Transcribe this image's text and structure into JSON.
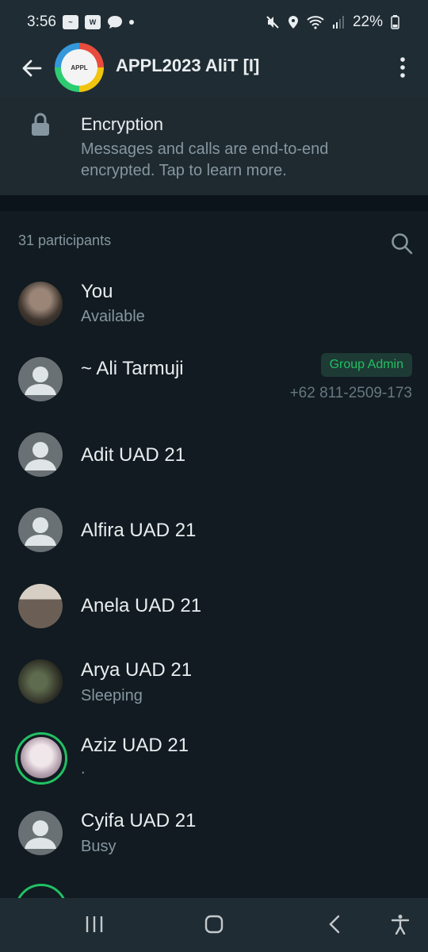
{
  "status_bar": {
    "time": "3:56",
    "battery": "22%",
    "left_icons": [
      "wechat-like-icon",
      "webtoon-icon",
      "chat-bubble-icon"
    ],
    "right_icons": [
      "mute-icon",
      "location-icon",
      "wifi-icon",
      "signal-icon",
      "battery-icon"
    ]
  },
  "header": {
    "title": "APPL2023 AliT [I]",
    "icons": [
      "back-arrow-icon",
      "more-vert-icon"
    ]
  },
  "encryption": {
    "title": "Encryption",
    "description": "Messages and calls are end-to-end encrypted. Tap to learn more."
  },
  "participants": {
    "count_label": "31 participants",
    "items": [
      {
        "name": "You",
        "about": "Available"
      },
      {
        "name": "~ Ali Tarmuji",
        "about": "",
        "badge": "Group Admin",
        "phone": "+62 811-2509-173"
      },
      {
        "name": "Adit UAD 21",
        "about": ""
      },
      {
        "name": "Alfira UAD 21",
        "about": ""
      },
      {
        "name": "Anela UAD 21",
        "about": ""
      },
      {
        "name": "Arya UAD 21",
        "about": "Sleeping"
      },
      {
        "name": "Aziz UAD 21",
        "about": "."
      },
      {
        "name": "Cyifa UAD 21",
        "about": "Busy"
      }
    ]
  },
  "nav_bar": {
    "icons": [
      "recents-icon",
      "home-icon",
      "back-icon",
      "accessibility-icon"
    ]
  },
  "colors": {
    "background": "#111b21",
    "bar": "#1f2c34",
    "accent": "#21c063",
    "secondary_text": "#8696a0"
  }
}
